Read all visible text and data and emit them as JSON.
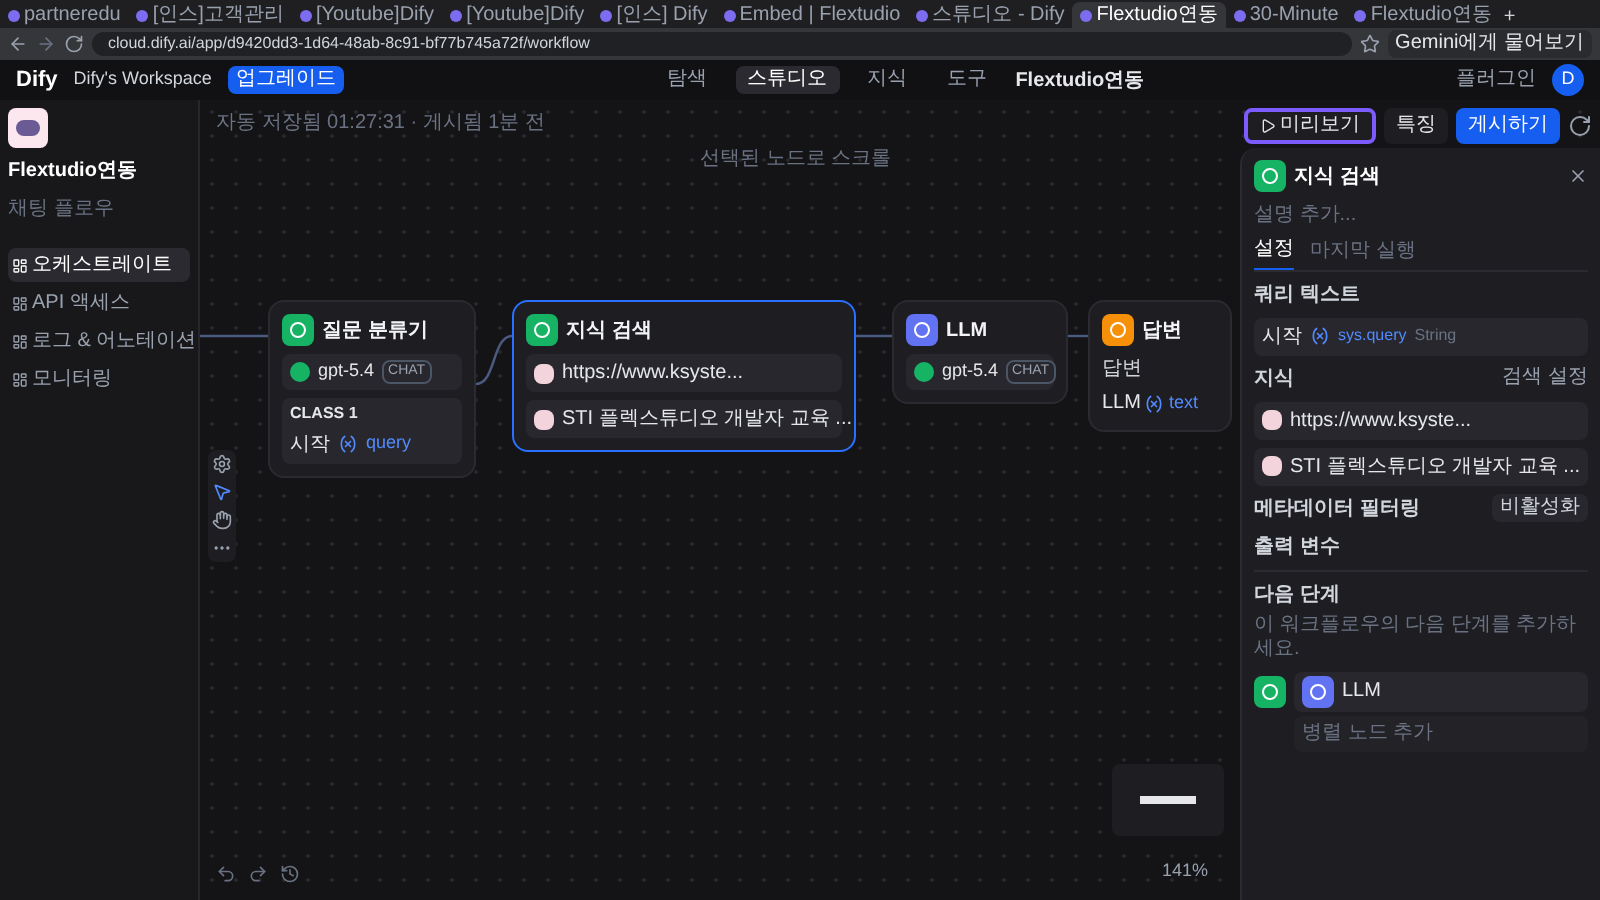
{
  "browser": {
    "tabs": [
      {
        "title": "partneredu",
        "selected": false
      },
      {
        "title": "[인스]고객관리",
        "selected": false
      },
      {
        "title": "[Youtube]Dify",
        "selected": false
      },
      {
        "title": "[Youtube]Dify",
        "selected": false
      },
      {
        "title": "[인스] Dify",
        "selected": false
      },
      {
        "title": "Embed | Flextudio",
        "selected": false
      },
      {
        "title": "스튜디오 - Dify",
        "selected": false
      },
      {
        "title": "Flextudio연동",
        "selected": true
      },
      {
        "title": "30-Minute",
        "selected": false
      },
      {
        "title": "Flextudio연동",
        "selected": false
      }
    ],
    "new_tab": "+",
    "gemini_button": "Gemini에게 물어보기",
    "url": "cloud.dify.ai/app/d9420dd3-1d64-48ab-8c91-bf77b745a72f/workflow"
  },
  "header": {
    "logo": "Dify",
    "workspace": "Dify's Workspace",
    "upgrade": "업그레이드",
    "nav": [
      {
        "label": "탐색",
        "selected": false
      },
      {
        "label": "스튜디오",
        "selected": true
      },
      {
        "label": "지식",
        "selected": false
      },
      {
        "label": "도구",
        "selected": false
      }
    ],
    "current_app": "Flextudio연동",
    "plugins": "플러그인",
    "avatar": "D"
  },
  "sidebar": {
    "app_name": "Flextudio연동",
    "app_type": "채팅 플로우",
    "items": [
      {
        "label": "오케스트레이트",
        "selected": true
      },
      {
        "label": "API 액세스",
        "selected": false
      },
      {
        "label": "로그 & 어노테이션",
        "selected": false
      },
      {
        "label": "모니터링",
        "selected": false
      }
    ]
  },
  "canvas": {
    "save_status": "자동 저장됨 01:27:31 · 게시됨 1분 전",
    "scroll_hint": "선택된 노드로 스크롤",
    "zoom": "141%",
    "toolbar": {
      "preview": "미리보기",
      "features": "특징",
      "publish": "게시하기"
    },
    "nodes": [
      {
        "kind": "classifier",
        "title": "질문 분류기",
        "selected": false,
        "model": "gpt-5.4",
        "mode": "CHAT",
        "class_label": "CLASS 1",
        "source": "시작",
        "variable": "query"
      },
      {
        "kind": "knowledge",
        "title": "지식 검색",
        "selected": true,
        "items": [
          "https://www.ksyste...",
          "STI 플렉스튜디오 개발자 교육 ..."
        ]
      },
      {
        "kind": "llm",
        "title": "LLM",
        "selected": false,
        "model": "gpt-5.4",
        "mode": "CHAT"
      },
      {
        "kind": "answer",
        "title": "답변",
        "selected": false,
        "field": "답변",
        "source": "LLM",
        "variable": "text"
      }
    ]
  },
  "panel": {
    "title": "지식 검색",
    "description_placeholder": "설명 추가...",
    "tabs": [
      {
        "label": "설정",
        "selected": true
      },
      {
        "label": "마지막 실행",
        "selected": false
      }
    ],
    "query_label": "쿼리 텍스트",
    "query_source": "시작",
    "query_variable": "sys.query",
    "query_type": "String",
    "knowledge_label": "지식",
    "retrieval_settings": "검색 설정",
    "knowledge_items": [
      "https://www.ksyste...",
      "STI 플렉스튜디오 개발자 교육 ..."
    ],
    "metadata_label": "메타데이터 필터링",
    "metadata_value": "비활성화",
    "output_label": "출력 변수",
    "next_label": "다음 단계",
    "next_hint": "이 워크플로우의 다음 단계를 추가하세요.",
    "next_node": "LLM",
    "add_parallel": "병렬 노드 추가"
  }
}
